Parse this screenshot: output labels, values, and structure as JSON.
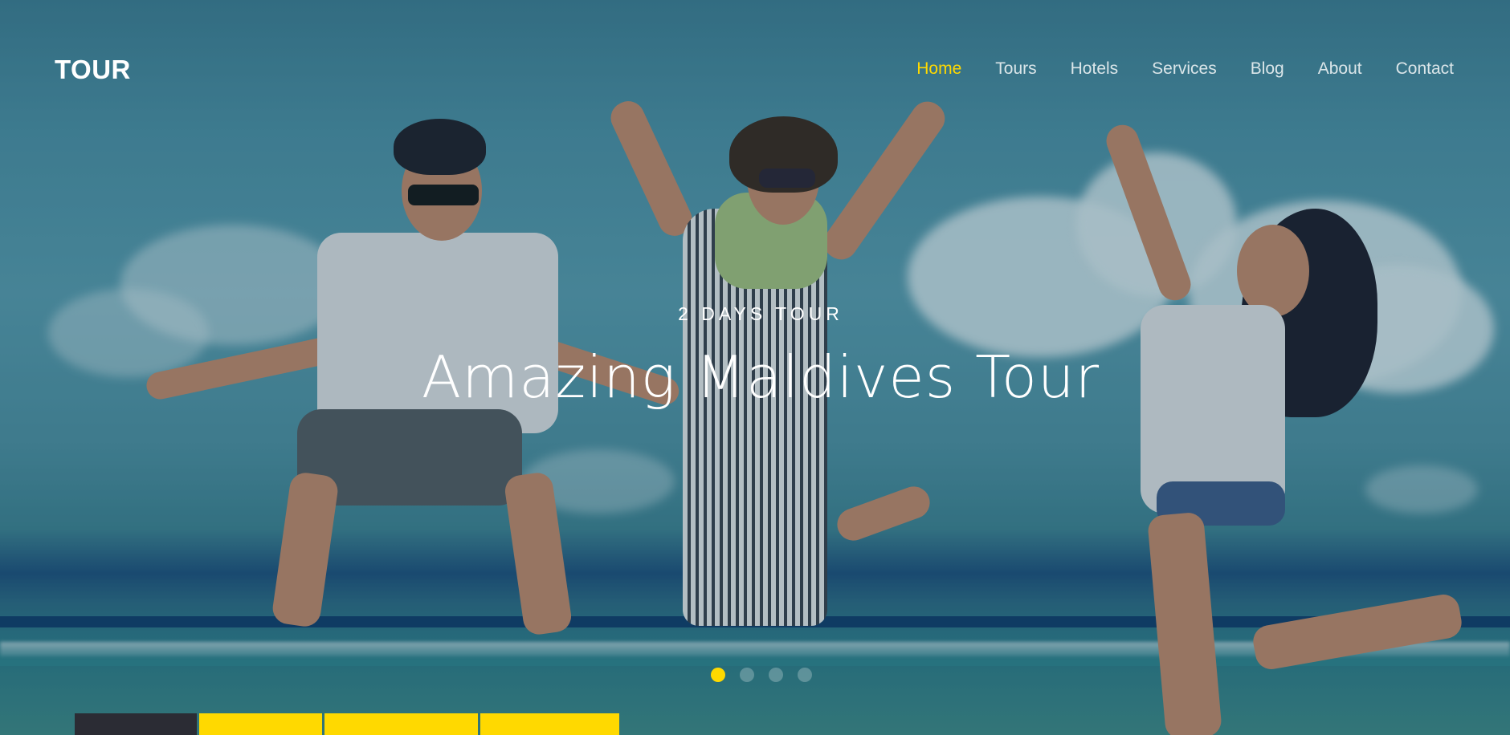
{
  "header": {
    "logo": "TOUR",
    "nav": [
      {
        "label": "Home",
        "active": true
      },
      {
        "label": "Tours",
        "active": false
      },
      {
        "label": "Hotels",
        "active": false
      },
      {
        "label": "Services",
        "active": false
      },
      {
        "label": "Blog",
        "active": false
      },
      {
        "label": "About",
        "active": false
      },
      {
        "label": "Contact",
        "active": false
      }
    ]
  },
  "hero": {
    "subtitle": "2 DAYS TOUR",
    "title": "Amazing Maldives Tour",
    "background_image": "three people jumping on a beach"
  },
  "slider": {
    "slide_count": 4,
    "active_index": 0
  },
  "colors": {
    "accent": "#ffd900",
    "tab_dark": "#2b2c34",
    "text": "#ffffff"
  }
}
